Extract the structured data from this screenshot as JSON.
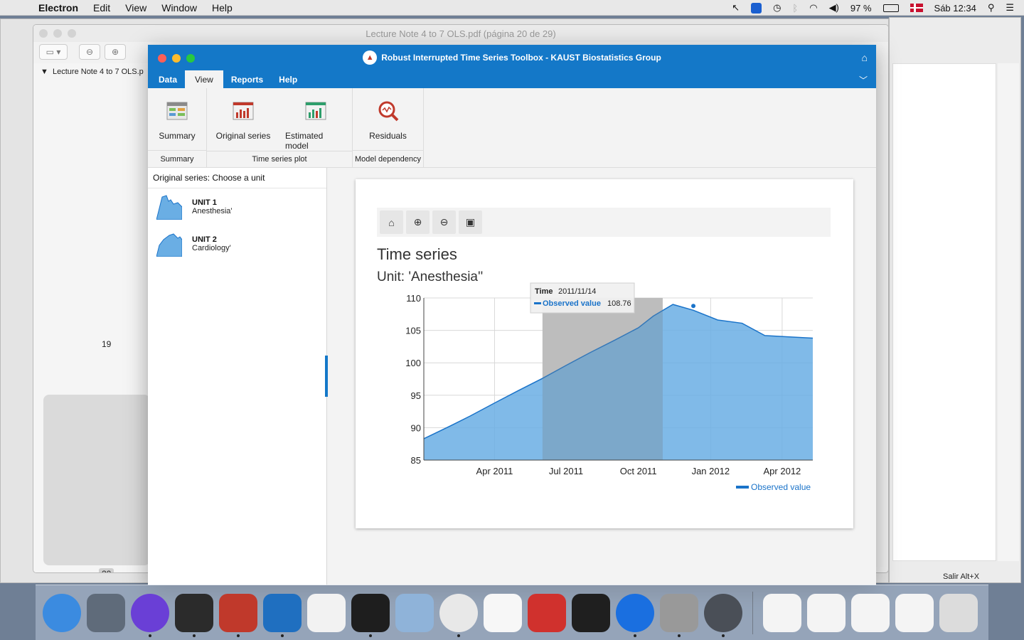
{
  "menubar": {
    "app_name": "Electron",
    "items": [
      "Edit",
      "View",
      "Window",
      "Help"
    ],
    "battery": "97 %",
    "clock": "Sáb 12:34"
  },
  "pdf_window": {
    "title": "Lecture Note 4 to 7 OLS.pdf (página 20 de 29)",
    "outline_item": "Lecture Note 4 to 7 OLS.p",
    "page_19": "19",
    "page_20": "20"
  },
  "app": {
    "title": "Robust Interrupted Time Series Toolbox - KAUST Biostatistics Group",
    "tabs": [
      "Data",
      "View",
      "Reports",
      "Help"
    ],
    "active_tab": "View",
    "ribbon": {
      "groups": [
        {
          "label": "Summary",
          "buttons": [
            "Summary"
          ]
        },
        {
          "label": "Time series plot",
          "buttons": [
            "Original series",
            "Estimated model"
          ]
        },
        {
          "label": "Model dependency",
          "buttons": [
            "Residuals"
          ]
        }
      ]
    },
    "left_panel": {
      "header": "Original series: Choose a unit",
      "units": [
        {
          "name": "UNIT 1",
          "desc": "Anesthesia'"
        },
        {
          "name": "UNIT 2",
          "desc": "Cardiology'"
        }
      ]
    },
    "chart_card": {
      "title": "Time series",
      "subtitle": "Unit: 'Anesthesia''",
      "tooltip": {
        "time_label": "Time",
        "time_value": "2011/11/14",
        "series_label": "Observed value",
        "series_value": "108.76"
      }
    }
  },
  "chart_data": {
    "type": "area",
    "title": "Time series",
    "subtitle": "Unit: 'Anesthesia''",
    "x": [
      "2011-01-01",
      "2011-02-01",
      "2011-03-01",
      "2011-04-01",
      "2011-05-01",
      "2011-06-01",
      "2011-07-01",
      "2011-08-01",
      "2011-09-01",
      "2011-10-01",
      "2011-10-20",
      "2011-11-14",
      "2011-12-10",
      "2012-01-10",
      "2012-02-10",
      "2012-03-10",
      "2012-04-10",
      "2012-05-10"
    ],
    "series": [
      {
        "name": "Observed value",
        "color": "#1a73c9",
        "fill": "#6aaee4",
        "values": [
          88.3,
          90.1,
          91.8,
          93.8,
          95.7,
          97.6,
          99.6,
          101.6,
          103.5,
          105.4,
          107.2,
          109.0,
          108.1,
          106.6,
          106.1,
          104.2,
          104.0,
          103.8
        ]
      }
    ],
    "ylim": [
      85,
      110
    ],
    "y_ticks": [
      85,
      90,
      95,
      100,
      105,
      110
    ],
    "x_ticks": [
      "Apr 2011",
      "Jul 2011",
      "Oct 2011",
      "Jan 2012",
      "Apr 2012"
    ],
    "highlight_range": [
      "2011-06-01",
      "2011-11-01"
    ],
    "highlighted_point": {
      "x": "2011-12-10",
      "y": 108.76
    },
    "legend": "bottom-right",
    "grid": true
  },
  "dock": {
    "icons": [
      "finder-icon",
      "launchpad-icon",
      "siri-icon",
      "app-icon",
      "photo-booth-icon",
      "vscode-icon",
      "notes-icon",
      "terminal-icon",
      "preview-icon",
      "chrome-icon",
      "textedit-icon",
      "parallels-icon",
      "activity-monitor-icon",
      "teamviewer-icon",
      "keychain-icon",
      "electron-icon",
      "document-icon",
      "document-icon",
      "document-icon",
      "document-icon",
      "trash-icon"
    ]
  },
  "bottom_right_label": "Salir Alt+X"
}
